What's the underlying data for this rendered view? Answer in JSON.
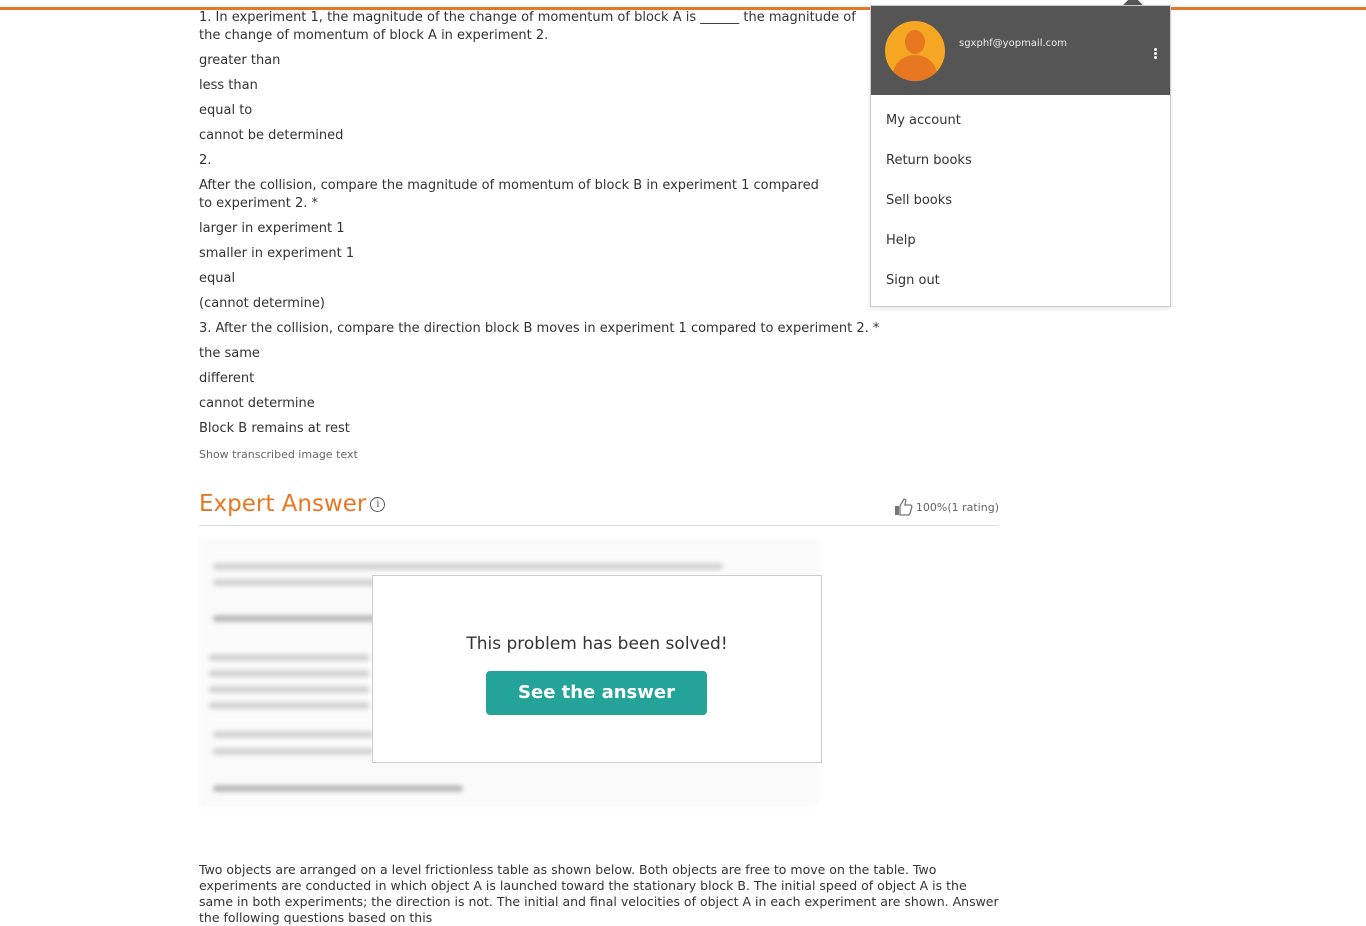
{
  "question1": {
    "prompt": "1. In experiment 1, the magnitude of the change of momentum of block A is ______ the magnitude of the change of momentum of block A in experiment 2.",
    "options": [
      "greater than",
      "less than",
      "equal to",
      "cannot be determined"
    ]
  },
  "question2": {
    "number": "2.",
    "prompt": "After the collision, compare the magnitude of momentum of block B in experiment 1 compared to experiment 2. *",
    "options": [
      "larger in experiment 1",
      "smaller in experiment 1",
      "equal",
      "(cannot determine)"
    ]
  },
  "question3": {
    "prompt": "3. After the collision, compare the direction block B moves in experiment 1 compared to experiment 2. *",
    "options": [
      "the same",
      "different",
      "cannot determine",
      "Block B remains at rest"
    ]
  },
  "show_transcribed": "Show transcribed image text",
  "expert_answer": {
    "title": "Expert Answer",
    "info_glyph": "i",
    "rating": "100%(1 rating)"
  },
  "solved": {
    "title": "This problem has been solved!",
    "button": "See the answer"
  },
  "bottom_paragraph": "Two objects are arranged on a level frictionless table as shown below. Both objects are free to move on the table. Two experiments are conducted in which object A is launched toward the stationary block B. The initial speed of object A is the same in both experiments; the direction is not. The initial and final velocities of object A in each experiment are shown. Answer the following questions based on this",
  "account_menu": {
    "email": "sgxphf@yopmail.com",
    "items": [
      "My account",
      "Return books",
      "Sell books",
      "Help",
      "Sign out"
    ]
  },
  "colors": {
    "accent": "#e87722",
    "button": "#24a399",
    "menu_header": "#555555"
  }
}
